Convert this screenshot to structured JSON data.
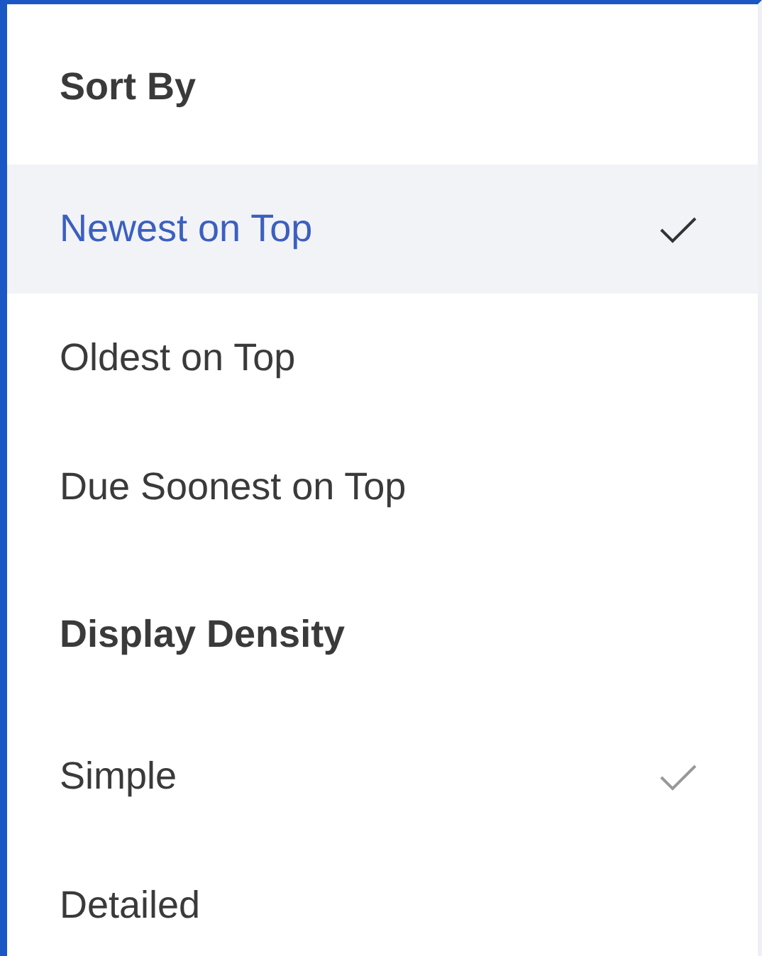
{
  "sections": [
    {
      "header": "Sort By",
      "items": [
        {
          "label": "Newest on Top",
          "selected": true,
          "checked": true
        },
        {
          "label": "Oldest on Top",
          "selected": false,
          "checked": false
        },
        {
          "label": "Due Soonest on Top",
          "selected": false,
          "checked": false
        }
      ]
    },
    {
      "header": "Display Density",
      "items": [
        {
          "label": "Simple",
          "selected": false,
          "checked": true
        },
        {
          "label": "Detailed",
          "selected": false,
          "checked": false
        }
      ]
    }
  ]
}
